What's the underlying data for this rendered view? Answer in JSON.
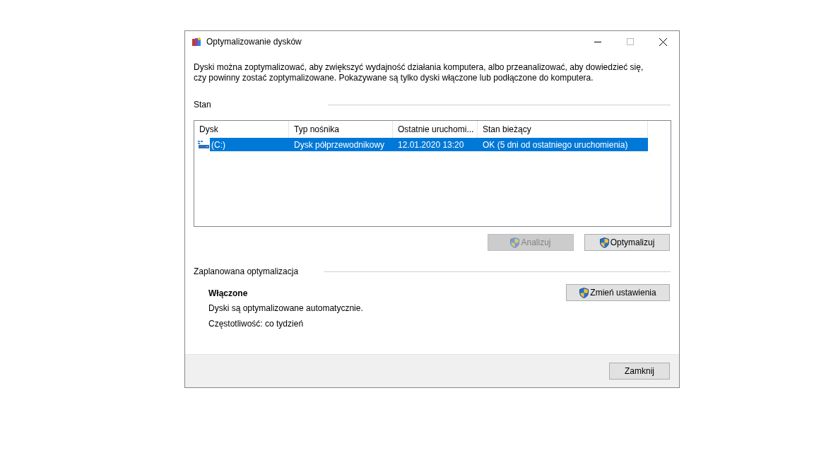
{
  "window": {
    "title": "Optymalizowanie dysków"
  },
  "description": "Dyski można zoptymalizować, aby zwiększyć wydajność działania komputera, albo przeanalizować, aby dowiedzieć się, czy powinny zostać zoptymalizowane. Pokazywane są tylko dyski włączone lub podłączone do komputera.",
  "status_section": {
    "label": "Stan"
  },
  "table": {
    "columns": [
      "Dysk",
      "Typ nośnika",
      "Ostatnie uruchomi...",
      "Stan bieżący"
    ],
    "rows": [
      {
        "cells": [
          "(C:)",
          "Dysk półprzewodnikowy",
          "12.01.2020 13:20",
          "OK (5 dni od ostatniego uruchomienia)"
        ],
        "selected": true
      }
    ]
  },
  "actions": [
    {
      "label": "Analizuj",
      "disabled": true
    },
    {
      "label": "Optymalizuj",
      "disabled": false
    }
  ],
  "schedule": {
    "label": "Zaplanowana optymalizacja",
    "state": "Włączone",
    "lines": [
      "Dyski są optymalizowane automatycznie.",
      "Częstotliwość: co tydzień"
    ],
    "button": {
      "label": "Zmień ustawienia",
      "disabled": false
    }
  },
  "close_button": {
    "label": "Zamknij"
  }
}
